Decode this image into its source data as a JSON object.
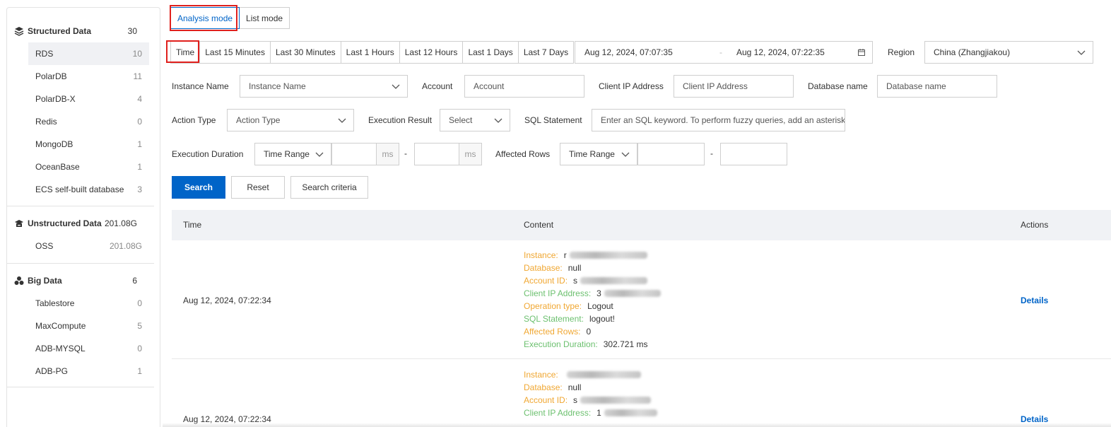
{
  "mode_tabs": [
    "Analysis mode",
    "List mode"
  ],
  "sidebar": {
    "groups": [
      {
        "title": "Structured Data",
        "count": "30",
        "icon": "layers-icon",
        "items": [
          {
            "label": "RDS",
            "count": "10"
          },
          {
            "label": "PolarDB",
            "count": "11"
          },
          {
            "label": "PolarDB-X",
            "count": "4"
          },
          {
            "label": "Redis",
            "count": "0"
          },
          {
            "label": "MongoDB",
            "count": "1"
          },
          {
            "label": "OceanBase",
            "count": "1"
          },
          {
            "label": "ECS self-built database",
            "count": "3"
          }
        ]
      },
      {
        "title": "Unstructured Data",
        "count": "201.08G",
        "icon": "archive-icon",
        "items": [
          {
            "label": "OSS",
            "count": "201.08G"
          }
        ]
      },
      {
        "title": "Big Data",
        "count": "6",
        "icon": "cluster-icon",
        "items": [
          {
            "label": "Tablestore",
            "count": "0"
          },
          {
            "label": "MaxCompute",
            "count": "5"
          },
          {
            "label": "ADB-MYSQL",
            "count": "0"
          },
          {
            "label": "ADB-PG",
            "count": "1"
          }
        ]
      }
    ]
  },
  "time_filter": {
    "buttons": [
      "Time",
      "Last 15 Minutes",
      "Last 30 Minutes",
      "Last 1 Hours",
      "Last 12 Hours",
      "Last 1 Days",
      "Last 7 Days"
    ],
    "start": "Aug 12, 2024, 07:07:35",
    "separator": "-",
    "end": "Aug 12, 2024, 07:22:35"
  },
  "region": {
    "label": "Region",
    "value": "China (Zhangjiakou)"
  },
  "filters": {
    "instance_name": {
      "label": "Instance Name",
      "placeholder": "Instance Name"
    },
    "account": {
      "label": "Account",
      "placeholder": "Account"
    },
    "client_ip": {
      "label": "Client IP Address",
      "placeholder": "Client IP Address"
    },
    "database_name": {
      "label": "Database name",
      "placeholder": "Database name"
    },
    "action_type": {
      "label": "Action Type",
      "placeholder": "Action Type"
    },
    "execution_result": {
      "label": "Execution Result",
      "placeholder": "Select"
    },
    "sql_statement": {
      "label": "SQL Statement",
      "placeholder": "Enter an SQL keyword. To perform fuzzy queries, add an asterisk"
    },
    "execution_duration": {
      "label": "Execution Duration",
      "select": "Time Range",
      "unit": "ms",
      "dash": "-"
    },
    "affected_rows": {
      "label": "Affected Rows",
      "select": "Time Range",
      "dash": "-"
    }
  },
  "actions": {
    "search": "Search",
    "reset": "Reset",
    "criteria": "Search criteria"
  },
  "table": {
    "columns": [
      "Time",
      "Content",
      "Actions"
    ],
    "rows": [
      {
        "time": "Aug 12, 2024, 07:22:34",
        "action": "Details",
        "fields": [
          {
            "key": "Instance",
            "value": "r"
          },
          {
            "key": "Database",
            "value": "null"
          },
          {
            "key": "Account ID",
            "value": "s"
          },
          {
            "key": "Client IP Address",
            "value": "3"
          },
          {
            "key": "Operation type",
            "value": "Logout"
          },
          {
            "key": "SQL Statement",
            "value": "logout!"
          },
          {
            "key": "Affected Rows",
            "value": "0"
          },
          {
            "key": "Execution Duration",
            "value": "302.721 ms"
          }
        ]
      },
      {
        "time": "Aug 12, 2024, 07:22:34",
        "action": "Details",
        "fields": [
          {
            "key": "Instance",
            "value": ""
          },
          {
            "key": "Database",
            "value": "null"
          },
          {
            "key": "Account ID",
            "value": "s"
          },
          {
            "key": "Client IP Address",
            "value": "1"
          }
        ]
      }
    ]
  },
  "colors": {
    "accent": "#0064c8",
    "highlight_box": "#e0201d",
    "key_orange": "#f0a732",
    "key_green": "#6cc06f"
  }
}
